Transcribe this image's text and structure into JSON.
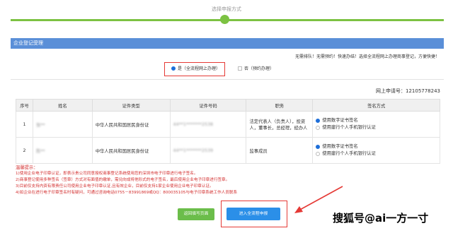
{
  "step": {
    "title": "选择申报方式"
  },
  "panel": {
    "title": "企业登记受理"
  },
  "notice": "无需排队！无需预约！快速办结！选择全流程网上办理商事登记，方便快捷！",
  "options": {
    "online": "是（全流程网上办理）",
    "offline": "否（预约办理）"
  },
  "reference": {
    "label": "网上申请号：",
    "value": "12105778243"
  },
  "table": {
    "headers": [
      "序号",
      "姓名",
      "证件类型",
      "证件号码",
      "职务",
      "签名方式"
    ],
    "rows": [
      {
        "index": "1",
        "name": "张**",
        "id_type": "中华人民共和国居民身份证",
        "id_number": "44**1*******2538",
        "role": "法定代表人（负责人），投资人，董事长，总经理，经办人",
        "sig_opt1": "使用数字证书签名",
        "sig_opt2": "使用建行个人手机银行认证"
      },
      {
        "index": "2",
        "name": "陈**",
        "id_type": "中华人民共和国居民身份证",
        "id_number": "44**1*******2539",
        "role": "监事成员",
        "sig_opt1": "使用数字证书签名",
        "sig_opt2": "使用建行个人手机银行认证"
      }
    ]
  },
  "warnings": {
    "title": "温馨提示：",
    "items": [
      "1)使用企业电子印章认证，即表示贵公司同意授权商事登记系统使用您的深圳市电子印章进行电子签名。",
      "2)商事登记使用多种签名（签章）方式对有面值的缴单，需兑向成将他形式的电子签名，最后使用企业电子印章进行签章。",
      "3)目前仅支持内资有限责任公司使用企业电子印章认证,且有效企业，目前仅支持1家企业使用企业电子印章认证。",
      "4)如企业在进行电子印章签名时有疑问，可通过咨询电话0755－83991869或QQ：800035105与电子印章系统工作人员联系"
    ]
  },
  "buttons": {
    "back": "返回填写页面",
    "proceed": "进入全流程申报"
  },
  "watermark": "搜狐号@ai一方一寸",
  "colors": {
    "accent": "#5a8fd8",
    "green": "#7cc242",
    "red": "#e53935",
    "blue": "#2b8fe8"
  }
}
